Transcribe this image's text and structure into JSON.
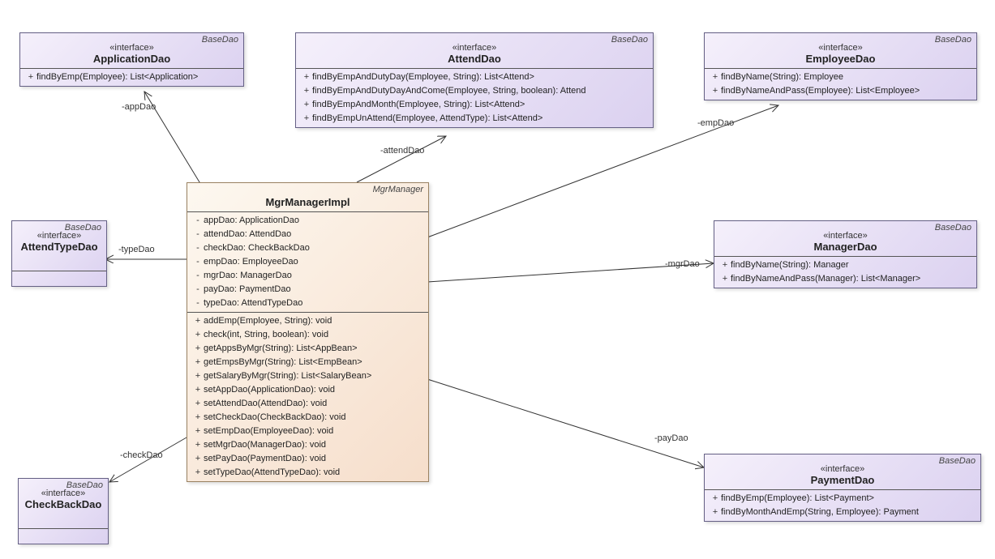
{
  "labels": {
    "interface": "«interface»",
    "baseDao": "BaseDao",
    "mgrManager": "MgrManager"
  },
  "applicationDao": {
    "name": "ApplicationDao",
    "ops": [
      {
        "vis": "+",
        "sig": "findByEmp(Employee): List<Application>"
      }
    ]
  },
  "attendDao": {
    "name": "AttendDao",
    "ops": [
      {
        "vis": "+",
        "sig": "findByEmpAndDutyDay(Employee, String): List<Attend>"
      },
      {
        "vis": "+",
        "sig": "findByEmpAndDutyDayAndCome(Employee, String, boolean): Attend"
      },
      {
        "vis": "+",
        "sig": "findByEmpAndMonth(Employee, String): List<Attend>"
      },
      {
        "vis": "+",
        "sig": "findByEmpUnAttend(Employee, AttendType): List<Attend>"
      }
    ]
  },
  "employeeDao": {
    "name": "EmployeeDao",
    "ops": [
      {
        "vis": "+",
        "sig": "findByName(String): Employee"
      },
      {
        "vis": "+",
        "sig": "findByNameAndPass(Employee): List<Employee>"
      }
    ]
  },
  "attendTypeDao": {
    "name": "AttendTypeDao"
  },
  "checkBackDao": {
    "name": "CheckBackDao"
  },
  "managerDao": {
    "name": "ManagerDao",
    "ops": [
      {
        "vis": "+",
        "sig": "findByName(String): Manager"
      },
      {
        "vis": "+",
        "sig": "findByNameAndPass(Manager): List<Manager>"
      }
    ]
  },
  "paymentDao": {
    "name": "PaymentDao",
    "ops": [
      {
        "vis": "+",
        "sig": "findByEmp(Employee): List<Payment>"
      },
      {
        "vis": "+",
        "sig": "findByMonthAndEmp(String, Employee): Payment"
      }
    ]
  },
  "mgrManagerImpl": {
    "name": "MgrManagerImpl",
    "attrs": [
      {
        "vis": "-",
        "sig": "appDao: ApplicationDao"
      },
      {
        "vis": "-",
        "sig": "attendDao: AttendDao"
      },
      {
        "vis": "-",
        "sig": "checkDao: CheckBackDao"
      },
      {
        "vis": "-",
        "sig": "empDao: EmployeeDao"
      },
      {
        "vis": "-",
        "sig": "mgrDao: ManagerDao"
      },
      {
        "vis": "-",
        "sig": "payDao: PaymentDao"
      },
      {
        "vis": "-",
        "sig": "typeDao: AttendTypeDao"
      }
    ],
    "ops": [
      {
        "vis": "+",
        "sig": "addEmp(Employee, String): void"
      },
      {
        "vis": "+",
        "sig": "check(int, String, boolean): void"
      },
      {
        "vis": "+",
        "sig": "getAppsByMgr(String): List<AppBean>"
      },
      {
        "vis": "+",
        "sig": "getEmpsByMgr(String): List<EmpBean>"
      },
      {
        "vis": "+",
        "sig": "getSalaryByMgr(String): List<SalaryBean>"
      },
      {
        "vis": "+",
        "sig": "setAppDao(ApplicationDao): void"
      },
      {
        "vis": "+",
        "sig": "setAttendDao(AttendDao): void"
      },
      {
        "vis": "+",
        "sig": "setCheckDao(CheckBackDao): void"
      },
      {
        "vis": "+",
        "sig": "setEmpDao(EmployeeDao): void"
      },
      {
        "vis": "+",
        "sig": "setMgrDao(ManagerDao): void"
      },
      {
        "vis": "+",
        "sig": "setPayDao(PaymentDao): void"
      },
      {
        "vis": "+",
        "sig": "setTypeDao(AttendTypeDao): void"
      }
    ]
  },
  "edges": {
    "appDao": "-appDao",
    "attendDao": "-attendDao",
    "empDao": "-empDao",
    "typeDao": "-typeDao",
    "checkDao": "-checkDao",
    "mgrDao": "-mgrDao",
    "payDao": "-payDao"
  }
}
